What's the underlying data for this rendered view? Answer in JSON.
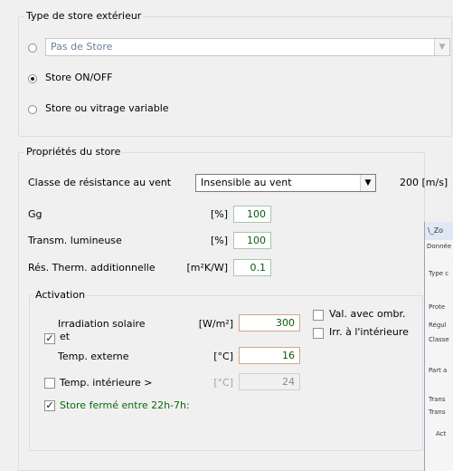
{
  "type_group": {
    "legend": "Type de store extérieur",
    "options": [
      {
        "label": "",
        "selected": false
      },
      {
        "label": "Store ON/OFF",
        "selected": true
      },
      {
        "label": "Store ou vitrage variable",
        "selected": false
      }
    ],
    "combo_value": "Pas de Store"
  },
  "props_group": {
    "legend": "Propriétés du store",
    "wind_label": "Classe de résistance au vent",
    "wind_value": "Insensible au vent",
    "wind_speed": "200 [m/s]",
    "gg_label": "Gg",
    "gg_unit": "[%]",
    "gg_value": "100",
    "transm_label": "Transm. lumineuse",
    "transm_unit": "[%]",
    "transm_value": "100",
    "res_label": "Rés. Therm. additionnelle",
    "res_unit": "[m²K/W]",
    "res_value": "0.1"
  },
  "activation": {
    "legend": "Activation",
    "irr_label": "Irradiation solaire",
    "irr_unit": "[W/m²]",
    "irr_value": "300",
    "and_label": "et",
    "and_checked": true,
    "temp_ext_label": "Temp. externe",
    "temp_ext_unit": "[°C]",
    "temp_ext_value": "16",
    "temp_int_label": "Temp. intérieure >",
    "temp_int_checked": false,
    "temp_int_unit": "[°C]",
    "temp_int_value": "24",
    "closed_label": "Store fermé entre 22h-7h:",
    "closed_checked": true,
    "shade_label": "Val. avec ombr.",
    "shade_checked": false,
    "irr_int_label": "Irr. à l'intérieure",
    "irr_int_checked": false
  },
  "background_window": {
    "title": "\\_Zo",
    "menu": "Donnée",
    "lines": [
      "Type c",
      "Prote",
      "Régul",
      "Classe",
      "Part a",
      "Trans",
      "Trans",
      "Act"
    ]
  }
}
